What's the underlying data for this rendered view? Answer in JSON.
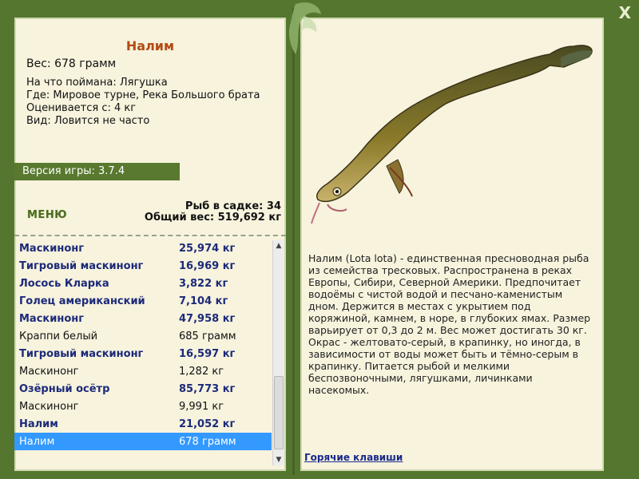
{
  "window": {
    "close_icon": "close-icon",
    "close_label": "X"
  },
  "fish": {
    "name": "Налим",
    "weight": "Вес: 678 грамм",
    "caught_with": "На что поймана: Лягушка",
    "location": "Где: Мировое турне, Река Большого брата",
    "rated_from": "Оценивается с: 4 кг",
    "kind": "Вид: Ловится не часто"
  },
  "version": "Версия игры: 3.7.4",
  "menu_label": "МЕНЮ",
  "stats": {
    "fish_in_cage": "Рыб в садке: 34",
    "total_weight": "Общий вес: 519,692 кг"
  },
  "catch_list": [
    {
      "name": "Маскинонг",
      "value": "25,974 кг",
      "style": "bold"
    },
    {
      "name": "Тигровый маскинонг",
      "value": "16,969 кг",
      "style": "bold"
    },
    {
      "name": "Лосось Кларка",
      "value": "3,822 кг",
      "style": "bold"
    },
    {
      "name": "Голец американский",
      "value": "7,104 кг",
      "style": "bold"
    },
    {
      "name": "Маскинонг",
      "value": "47,958 кг",
      "style": "bold"
    },
    {
      "name": "Краппи белый",
      "value": "685 грамм",
      "style": "plain"
    },
    {
      "name": "Тигровый маскинонг",
      "value": "16,597 кг",
      "style": "bold"
    },
    {
      "name": "Маскинонг",
      "value": "1,282 кг",
      "style": "plain"
    },
    {
      "name": "Озёрный осётр",
      "value": "85,773 кг",
      "style": "bold"
    },
    {
      "name": "Маскинонг",
      "value": "9,991 кг",
      "style": "plain"
    },
    {
      "name": "Налим",
      "value": "21,052 кг",
      "style": "bold"
    },
    {
      "name": "Налим",
      "value": "678 грамм",
      "style": "selected"
    }
  ],
  "description": "Налим (Lota lota) - единственная пресноводная рыба из семейства тресковых. Распространена в реках Европы, Сибири, Северной Америки. Предпочитает водоёмы с чистой водой и песчано-каменистым дном. Держится в местах с укрытием под коряжиной, камнем, в норе, в глубоких ямах. Размер варьирует от 0,3 до 2 м. Вес может достигать 30 кг. Окрас - желтовато-серый, в крапинку, но иногда, в зависимости от воды может быть и тёмно-серым в крапинку. Питается рыбой и мелкими беспозвоночными, лягушками, личинками насекомых.",
  "hotkeys_label": "Горячие клавиши",
  "colors": {
    "frame": "#55762e",
    "panel": "#f7f3dd",
    "title": "#b34b14",
    "link": "#1a2a8a",
    "selected": "#3399ff"
  }
}
